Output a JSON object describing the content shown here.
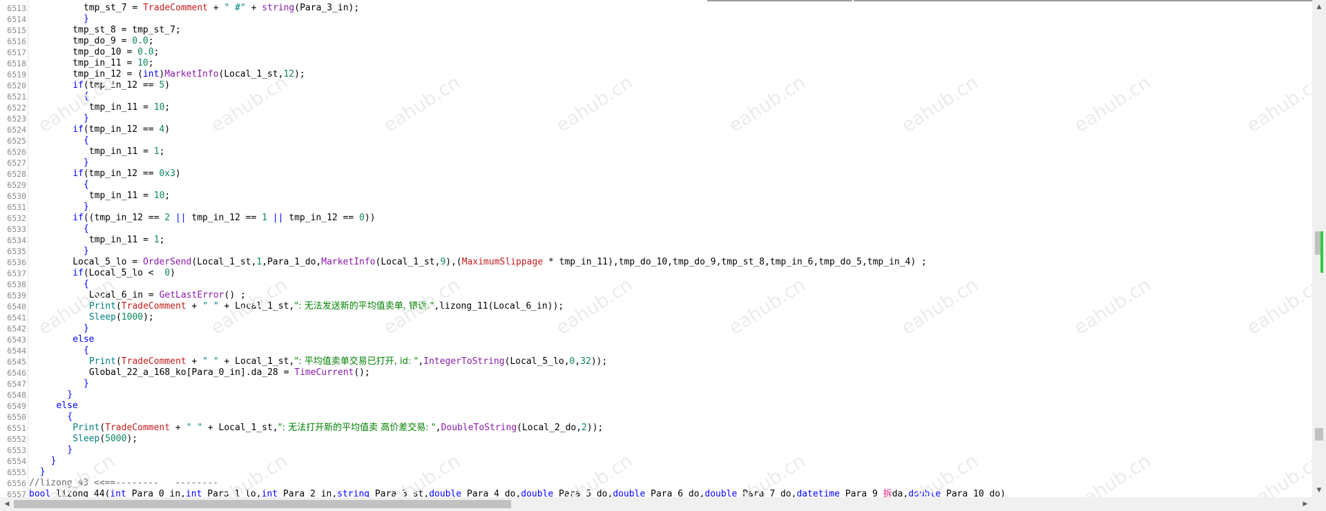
{
  "editor": {
    "lines": [
      {
        "num": "6513",
        "indent": 10,
        "tokens": [
          [
            "",
            "tmp_st_7 = "
          ],
          [
            "var",
            "TradeComment"
          ],
          [
            "",
            " + "
          ],
          [
            "str",
            "\" #\""
          ],
          [
            "",
            " + "
          ],
          [
            "fn",
            "string"
          ],
          [
            "",
            "(Para_3_in);"
          ]
        ]
      },
      {
        "num": "6514",
        "indent": 10,
        "tokens": [
          [
            "kw",
            "}"
          ]
        ]
      },
      {
        "num": "6515",
        "indent": 8,
        "tokens": [
          [
            "",
            "tmp_st_8 = tmp_st_7;"
          ]
        ]
      },
      {
        "num": "6516",
        "indent": 8,
        "tokens": [
          [
            "",
            "tmp_do_9 = "
          ],
          [
            "num",
            "0.0"
          ],
          [
            "",
            ";"
          ]
        ]
      },
      {
        "num": "6517",
        "indent": 8,
        "tokens": [
          [
            "",
            "tmp_do_10 = "
          ],
          [
            "num",
            "0.0"
          ],
          [
            "",
            ";"
          ]
        ]
      },
      {
        "num": "6518",
        "indent": 8,
        "tokens": [
          [
            "",
            "tmp_in_11 = "
          ],
          [
            "num",
            "10"
          ],
          [
            "",
            ";"
          ]
        ]
      },
      {
        "num": "6519",
        "indent": 8,
        "tokens": [
          [
            "",
            "tmp_in_12 = ("
          ],
          [
            "kw",
            "int"
          ],
          [
            "",
            ")"
          ],
          [
            "fn",
            "MarketInfo"
          ],
          [
            "",
            "(Local_1_st,"
          ],
          [
            "num",
            "12"
          ],
          [
            "",
            ");"
          ]
        ]
      },
      {
        "num": "6520",
        "indent": 8,
        "tokens": [
          [
            "kw",
            "if"
          ],
          [
            "",
            "(tmp_in_12 == "
          ],
          [
            "num",
            "5"
          ],
          [
            "",
            ")"
          ]
        ]
      },
      {
        "num": "6521",
        "indent": 10,
        "tokens": [
          [
            "kw",
            "{"
          ]
        ]
      },
      {
        "num": "6522",
        "indent": 10,
        "tokens": [
          [
            "",
            " tmp_in_11 = "
          ],
          [
            "num",
            "10"
          ],
          [
            "",
            ";"
          ]
        ]
      },
      {
        "num": "6523",
        "indent": 10,
        "tokens": [
          [
            "kw",
            "}"
          ]
        ]
      },
      {
        "num": "6524",
        "indent": 8,
        "tokens": [
          [
            "kw",
            "if"
          ],
          [
            "",
            "(tmp_in_12 == "
          ],
          [
            "num",
            "4"
          ],
          [
            "",
            ")"
          ]
        ]
      },
      {
        "num": "6525",
        "indent": 10,
        "tokens": [
          [
            "kw",
            "{"
          ]
        ]
      },
      {
        "num": "6526",
        "indent": 10,
        "tokens": [
          [
            "",
            " tmp_in_11 = "
          ],
          [
            "num",
            "1"
          ],
          [
            "",
            ";"
          ]
        ]
      },
      {
        "num": "6527",
        "indent": 10,
        "tokens": [
          [
            "kw",
            "}"
          ]
        ]
      },
      {
        "num": "6528",
        "indent": 8,
        "tokens": [
          [
            "kw",
            "if"
          ],
          [
            "",
            "(tmp_in_12 == "
          ],
          [
            "num",
            "0x3"
          ],
          [
            "",
            ")"
          ]
        ]
      },
      {
        "num": "6529",
        "indent": 10,
        "tokens": [
          [
            "kw",
            "{"
          ]
        ]
      },
      {
        "num": "6530",
        "indent": 10,
        "tokens": [
          [
            "",
            " tmp_in_11 = "
          ],
          [
            "num",
            "10"
          ],
          [
            "",
            ";"
          ]
        ]
      },
      {
        "num": "6531",
        "indent": 10,
        "tokens": [
          [
            "kw",
            "}"
          ]
        ]
      },
      {
        "num": "6532",
        "indent": 8,
        "tokens": [
          [
            "kw",
            "if"
          ],
          [
            "",
            "((tmp_in_12 == "
          ],
          [
            "num",
            "2"
          ],
          [
            "",
            " "
          ],
          [
            "kw",
            "||"
          ],
          [
            "",
            " tmp_in_12 == "
          ],
          [
            "num",
            "1"
          ],
          [
            "",
            " "
          ],
          [
            "kw",
            "||"
          ],
          [
            "",
            " tmp_in_12 == "
          ],
          [
            "num",
            "0"
          ],
          [
            "",
            "))"
          ]
        ]
      },
      {
        "num": "6533",
        "indent": 10,
        "tokens": [
          [
            "kw",
            "{"
          ]
        ]
      },
      {
        "num": "6534",
        "indent": 10,
        "tokens": [
          [
            "",
            " tmp_in_11 = "
          ],
          [
            "num",
            "1"
          ],
          [
            "",
            ";"
          ]
        ]
      },
      {
        "num": "6535",
        "indent": 10,
        "tokens": [
          [
            "kw",
            "}"
          ]
        ]
      },
      {
        "num": "6536",
        "indent": 8,
        "tokens": [
          [
            "",
            "Local_5_lo = "
          ],
          [
            "fn",
            "OrderSend"
          ],
          [
            "",
            "(Local_1_st,"
          ],
          [
            "num",
            "1"
          ],
          [
            "",
            ",Para_1_do,"
          ],
          [
            "fn",
            "MarketInfo"
          ],
          [
            "",
            "(Local_1_st,"
          ],
          [
            "num",
            "9"
          ],
          [
            "",
            "),("
          ],
          [
            "var",
            "MaximumSlippage"
          ],
          [
            "",
            " * tmp_in_11),tmp_do_10,tmp_do_9,tmp_st_8,tmp_in_6,tmp_do_5,tmp_in_4) ;"
          ]
        ]
      },
      {
        "num": "6537",
        "indent": 8,
        "tokens": [
          [
            "kw",
            "if"
          ],
          [
            "",
            "(Local_5_lo <  "
          ],
          [
            "num",
            "0"
          ],
          [
            "",
            ")"
          ]
        ]
      },
      {
        "num": "6538",
        "indent": 10,
        "tokens": [
          [
            "kw",
            "{"
          ]
        ]
      },
      {
        "num": "6539",
        "indent": 10,
        "tokens": [
          [
            "",
            " Local_6_in = "
          ],
          [
            "fn",
            "GetLastError"
          ],
          [
            "",
            "() ;"
          ]
        ]
      },
      {
        "num": "6540",
        "indent": 10,
        "tokens": [
          [
            "",
            " "
          ],
          [
            "str",
            "Print"
          ],
          [
            "",
            "("
          ],
          [
            "var",
            "TradeComment"
          ],
          [
            "",
            " + "
          ],
          [
            "str",
            "\" \""
          ],
          [
            "",
            " + Local_1_st,"
          ],
          [
            "zh",
            "\": 无法发送新的平均值卖单, 错误:\""
          ],
          [
            "",
            ",lizong_11(Local_6_in));"
          ]
        ]
      },
      {
        "num": "6541",
        "indent": 10,
        "tokens": [
          [
            "",
            " "
          ],
          [
            "str",
            "Sleep"
          ],
          [
            "",
            "("
          ],
          [
            "num",
            "1000"
          ],
          [
            "",
            ");"
          ]
        ]
      },
      {
        "num": "6542",
        "indent": 10,
        "tokens": [
          [
            "kw",
            "}"
          ]
        ]
      },
      {
        "num": "6543",
        "indent": 8,
        "tokens": [
          [
            "kw",
            "else"
          ]
        ]
      },
      {
        "num": "6544",
        "indent": 10,
        "tokens": [
          [
            "kw",
            "{"
          ]
        ]
      },
      {
        "num": "6545",
        "indent": 10,
        "tokens": [
          [
            "",
            " "
          ],
          [
            "str",
            "Print"
          ],
          [
            "",
            "("
          ],
          [
            "var",
            "TradeComment"
          ],
          [
            "",
            " + "
          ],
          [
            "str",
            "\" \""
          ],
          [
            "",
            " + Local_1_st,"
          ],
          [
            "zh",
            "\": 平均值卖单交易已打开, id: \""
          ],
          [
            "",
            ","
          ],
          [
            "fn",
            "IntegerToString"
          ],
          [
            "",
            "(Local_5_lo,"
          ],
          [
            "num",
            "0"
          ],
          [
            "",
            ","
          ],
          [
            "num",
            "32"
          ],
          [
            "",
            "));"
          ]
        ]
      },
      {
        "num": "6546",
        "indent": 10,
        "tokens": [
          [
            "",
            " Global_22_a_168_ko[Para_0_in].da_28 = "
          ],
          [
            "fn",
            "TimeCurrent"
          ],
          [
            "",
            "();"
          ]
        ]
      },
      {
        "num": "6547",
        "indent": 10,
        "tokens": [
          [
            "kw",
            "}"
          ]
        ]
      },
      {
        "num": "6548",
        "indent": 7,
        "tokens": [
          [
            "kw",
            "}"
          ]
        ]
      },
      {
        "num": "6549",
        "indent": 5,
        "tokens": [
          [
            "kw",
            "else"
          ]
        ]
      },
      {
        "num": "6550",
        "indent": 7,
        "tokens": [
          [
            "kw",
            "{"
          ]
        ]
      },
      {
        "num": "6551",
        "indent": 8,
        "tokens": [
          [
            "str",
            "Print"
          ],
          [
            "",
            "("
          ],
          [
            "var",
            "TradeComment"
          ],
          [
            "",
            " + "
          ],
          [
            "str",
            "\" \""
          ],
          [
            "",
            " + Local_1_st,"
          ],
          [
            "zh",
            "\": 无法打开新的平均值卖 高价差交易: \""
          ],
          [
            "",
            ","
          ],
          [
            "fn",
            "DoubleToString"
          ],
          [
            "",
            "(Local_2_do,"
          ],
          [
            "num",
            "2"
          ],
          [
            "",
            "));"
          ]
        ]
      },
      {
        "num": "6552",
        "indent": 8,
        "tokens": [
          [
            "str",
            "Sleep"
          ],
          [
            "",
            "("
          ],
          [
            "num",
            "5000"
          ],
          [
            "",
            ");"
          ]
        ]
      },
      {
        "num": "6553",
        "indent": 7,
        "tokens": [
          [
            "kw",
            "}"
          ]
        ]
      },
      {
        "num": "6554",
        "indent": 4,
        "tokens": [
          [
            "kw",
            "}"
          ]
        ]
      },
      {
        "num": "6555",
        "indent": 2,
        "tokens": [
          [
            "kw",
            "}"
          ]
        ]
      },
      {
        "num": "6556",
        "indent": 0,
        "tokens": [
          [
            "cmt",
            "//lizong_43 <<==--------   --------"
          ]
        ]
      },
      {
        "num": "6557",
        "indent": 0,
        "tokens": [
          [
            "kw",
            "bool"
          ],
          [
            "",
            " lizong_44("
          ],
          [
            "kw",
            "int"
          ],
          [
            "",
            " Para_0_in,"
          ],
          [
            "kw",
            "int"
          ],
          [
            "",
            " Para_1_lo,"
          ],
          [
            "kw",
            "int"
          ],
          [
            "",
            " Para_2_in,"
          ],
          [
            "kw",
            "string"
          ],
          [
            "",
            " Para_3_st,"
          ],
          [
            "kw",
            "double"
          ],
          [
            "",
            " Para_4_do,"
          ],
          [
            "kw",
            "double"
          ],
          [
            "",
            " Para_5_do,"
          ],
          [
            "kw",
            "double"
          ],
          [
            "",
            " Para_6_do,"
          ],
          [
            "kw",
            "double"
          ],
          [
            "",
            " Para_7_do,"
          ],
          [
            "kw",
            "datetime"
          ],
          [
            "",
            " Para_9_"
          ],
          [
            "pk",
            "拆"
          ],
          [
            "",
            "da,"
          ],
          [
            "kw",
            "double"
          ],
          [
            "",
            " Para_10_do)"
          ]
        ]
      }
    ]
  },
  "watermark": {
    "text": "eahub.cn",
    "color": "#ebebeb"
  },
  "scrollbars": {
    "vertical": {
      "up_icon": "▲",
      "down_icon": "▼",
      "position_fraction": 0.43
    },
    "horizontal": {
      "left_icon": "◀",
      "right_icon": "▶",
      "visible_fraction": 0.39
    }
  },
  "colors": {
    "keyword": "#0000ff",
    "function": "#8b1aa8",
    "variable": "#c21b1b",
    "number": "#098658",
    "string": "#008080",
    "chinese_text": "#008000",
    "overview_mark": "#2ecc40"
  }
}
